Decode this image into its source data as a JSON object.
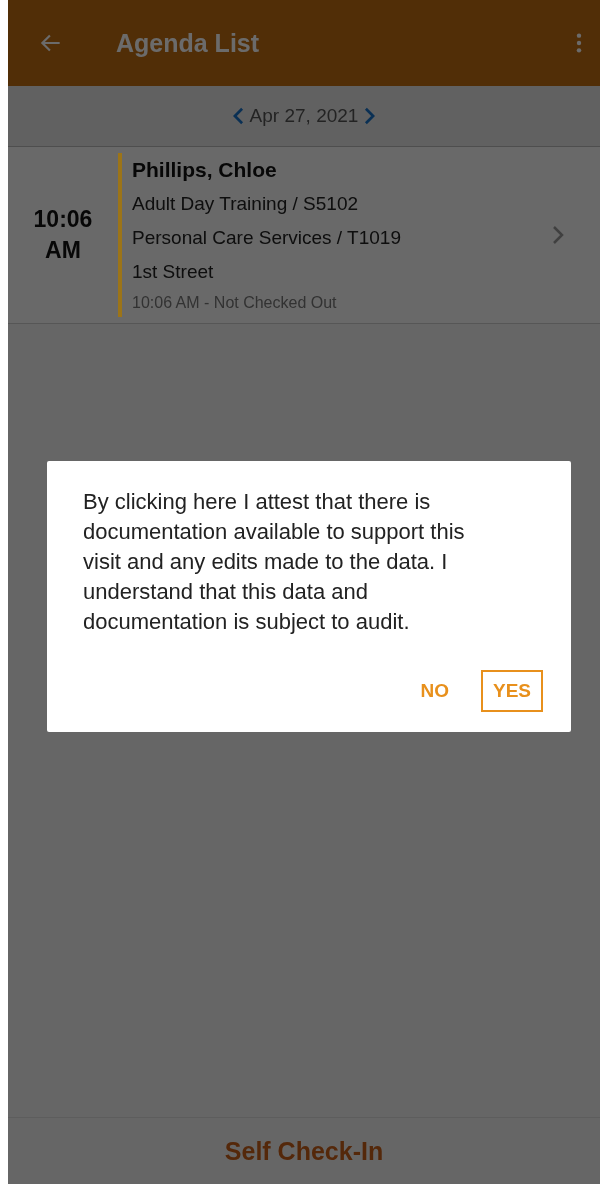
{
  "app_bar": {
    "title": "Agenda List"
  },
  "date_nav": {
    "date": "Apr 27, 2021"
  },
  "agenda": [
    {
      "time": "10:06",
      "period": "AM",
      "name": "Phillips, Chloe",
      "lines": [
        "Adult Day Training / S5102",
        "Personal Care Services / T1019",
        "1st Street"
      ],
      "status": "10:06 AM - Not Checked Out",
      "color": "#9c7418"
    }
  ],
  "footer": {
    "action": "Self Check-In"
  },
  "dialog": {
    "message": "By clicking here I attest that there is documentation available to support this visit and any edits made to the data. I understand that this data and documentation is subject to audit.",
    "buttons": [
      {
        "label": "NO",
        "kind": "text"
      },
      {
        "label": "YES",
        "kind": "outlined"
      }
    ]
  }
}
